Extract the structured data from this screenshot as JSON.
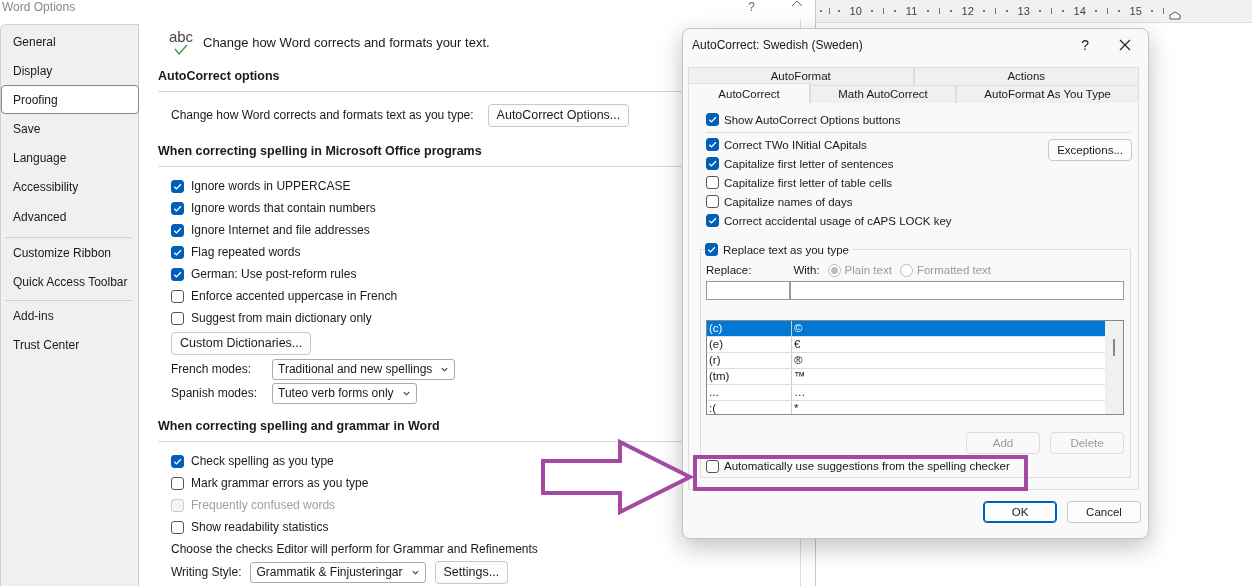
{
  "word_options": {
    "title": "Word Options",
    "help": "?",
    "sidebar": {
      "groups": [
        [
          {
            "label": "General",
            "selected": false
          },
          {
            "label": "Display",
            "selected": false
          },
          {
            "label": "Proofing",
            "selected": true
          },
          {
            "label": "Save",
            "selected": false
          },
          {
            "label": "Language",
            "selected": false
          },
          {
            "label": "Accessibility",
            "selected": false
          },
          {
            "label": "Advanced",
            "selected": false
          }
        ],
        [
          {
            "label": "Customize Ribbon",
            "selected": false
          },
          {
            "label": "Quick Access Toolbar",
            "selected": false
          }
        ],
        [
          {
            "label": "Add-ins",
            "selected": false
          },
          {
            "label": "Trust Center",
            "selected": false
          }
        ]
      ]
    },
    "header_icon_text": "abc",
    "header": "Change how Word corrects and formats your text.",
    "sections": [
      {
        "heading": "AutoCorrect options",
        "items": [
          {
            "kind": "button_row",
            "label": "Change how Word corrects and formats text as you type:",
            "button": "AutoCorrect Options..."
          }
        ]
      },
      {
        "heading": "When correcting spelling in Microsoft Office programs",
        "items": [
          {
            "kind": "checkbox",
            "label": "Ignore words in UPPERCASE",
            "checked": true,
            "disabled": false
          },
          {
            "kind": "checkbox",
            "label": "Ignore words that contain numbers",
            "checked": true,
            "disabled": false
          },
          {
            "kind": "checkbox",
            "label": "Ignore Internet and file addresses",
            "checked": true,
            "disabled": false
          },
          {
            "kind": "checkbox",
            "label": "Flag repeated words",
            "checked": true,
            "disabled": false
          },
          {
            "kind": "checkbox",
            "label": "German: Use post-reform rules",
            "checked": true,
            "disabled": false
          },
          {
            "kind": "checkbox",
            "label": "Enforce accented uppercase in French",
            "checked": false,
            "disabled": false
          },
          {
            "kind": "checkbox",
            "label": "Suggest from main dictionary only",
            "checked": false,
            "disabled": false
          },
          {
            "kind": "button",
            "label": "Custom Dictionaries..."
          },
          {
            "kind": "select",
            "label": "French modes:",
            "value": "Traditional and new spellings"
          },
          {
            "kind": "select",
            "label": "Spanish modes:",
            "value": "Tuteo verb forms only"
          }
        ]
      },
      {
        "heading": "When correcting spelling and grammar in Word",
        "items": [
          {
            "kind": "checkbox",
            "label": "Check spelling as you type",
            "checked": true,
            "disabled": false
          },
          {
            "kind": "checkbox",
            "label": "Mark grammar errors as you type",
            "checked": false,
            "disabled": false
          },
          {
            "kind": "checkbox",
            "label": "Frequently confused words",
            "checked": false,
            "disabled": true
          },
          {
            "kind": "checkbox",
            "label": "Show readability statistics",
            "checked": false,
            "disabled": false
          },
          {
            "kind": "text",
            "text": "Choose the checks Editor will perform for Grammar and Refinements"
          },
          {
            "kind": "select_button",
            "label": "Writing Style:",
            "value": "Grammatik & Finjusteringar",
            "button": "Settings..."
          }
        ]
      }
    ]
  },
  "ruler": {
    "numbers": [
      "10",
      "11",
      "12",
      "13",
      "14",
      "15"
    ]
  },
  "dialog": {
    "title": "AutoCorrect: Swedish (Sweden)",
    "help": "?",
    "tab_rows": [
      [
        {
          "label": "AutoFormat",
          "selected": false
        },
        {
          "label": "Actions",
          "selected": false
        }
      ],
      [
        {
          "label": "AutoCorrect",
          "selected": true
        },
        {
          "label": "Math AutoCorrect",
          "selected": false
        },
        {
          "label": "AutoFormat As You Type",
          "selected": false
        }
      ]
    ],
    "show_buttons": {
      "label": "Show AutoCorrect Options buttons",
      "checked": true
    },
    "options": [
      {
        "label": "Correct TWo INitial CApitals",
        "checked": true
      },
      {
        "label": "Capitalize first letter of sentences",
        "checked": true
      },
      {
        "label": "Capitalize first letter of table cells",
        "checked": false
      },
      {
        "label": "Capitalize names of days",
        "checked": false
      },
      {
        "label": "Correct accidental usage of cAPS LOCK key",
        "checked": true
      }
    ],
    "exceptions_button": "Exceptions...",
    "replace_group": {
      "label": "Replace text as you type",
      "checked": true,
      "replace_label": "Replace:",
      "with_label": "With:",
      "formats": [
        {
          "label": "Plain text",
          "selected": true
        },
        {
          "label": "Formatted text",
          "selected": false
        }
      ],
      "entries": [
        {
          "replace": "(c)",
          "with": "©",
          "selected": true
        },
        {
          "replace": "(e)",
          "with": "€",
          "selected": false
        },
        {
          "replace": "(r)",
          "with": "®",
          "selected": false
        },
        {
          "replace": "(tm)",
          "with": "™",
          "selected": false
        },
        {
          "replace": "...",
          "with": "…",
          "selected": false
        },
        {
          "replace": ":(",
          "with": "*",
          "selected": false
        }
      ],
      "buttons": [
        {
          "label": "Add",
          "disabled": true
        },
        {
          "label": "Delete",
          "disabled": true
        }
      ],
      "auto_suggest": {
        "label": "Automatically use suggestions from the spelling checker",
        "checked": false
      }
    },
    "footer_buttons": [
      {
        "label": "OK",
        "default": true
      },
      {
        "label": "Cancel",
        "default": false
      }
    ]
  }
}
